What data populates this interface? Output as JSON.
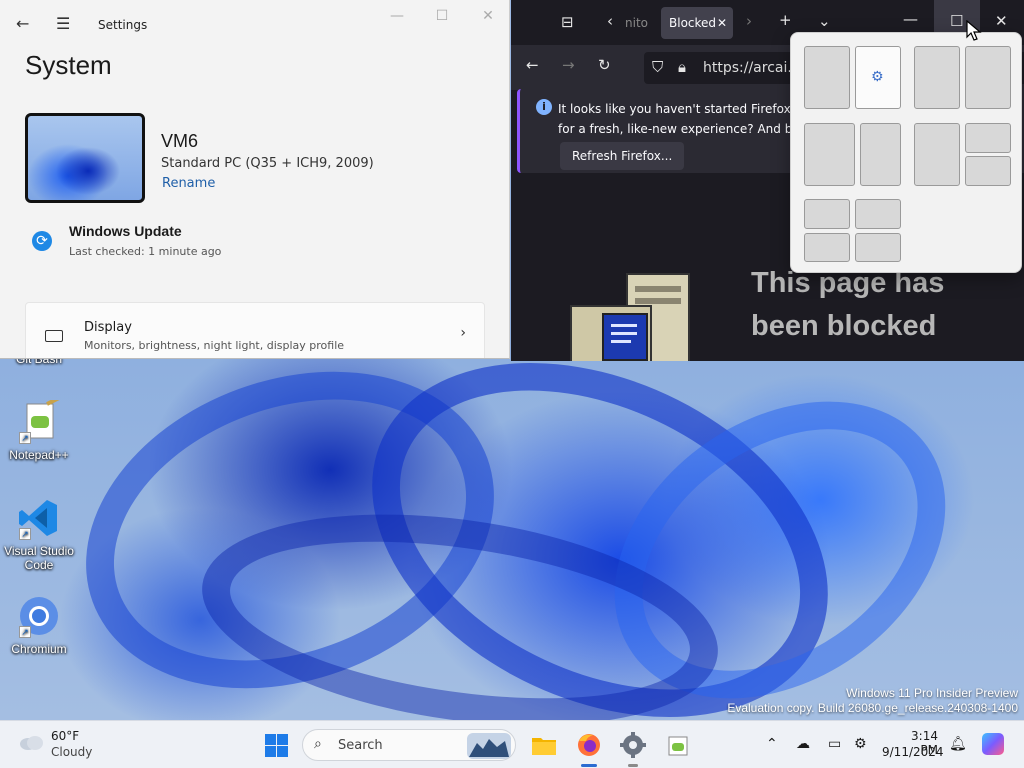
{
  "desktop": {
    "icons": [
      {
        "label": "Git Bash"
      },
      {
        "label": "Notepad++"
      },
      {
        "label": "Visual Studio Code"
      },
      {
        "label": "Chromium"
      }
    ],
    "watermark_line1": "Windows 11 Pro Insider Preview",
    "watermark_line2": "Evaluation copy. Build 26080.ge_release.240308-1400"
  },
  "settings": {
    "window_title": "Settings",
    "heading": "System",
    "device_name": "VM6",
    "device_model": "Standard PC (Q35 + ICH9, 2009)",
    "rename_link": "Rename",
    "update_title": "Windows Update",
    "update_sub": "Last checked: 1 minute ago",
    "display_title": "Display",
    "display_sub": "Monitors, brightness, night light, display profile"
  },
  "firefox": {
    "partial_tab": "nito",
    "active_tab": "Blocked",
    "url": "https://arcai.co",
    "notification_line1": "It looks like you haven't started Firefox in a w",
    "notification_line2": "for a fresh, like-new experience? And by the w",
    "refresh_button": "Refresh Firefox...",
    "blocked_line1": "This page has",
    "blocked_line2": "been blocked"
  },
  "taskbar": {
    "weather_temp": "60°F",
    "weather_desc": "Cloudy",
    "search_label": "Search",
    "time": "3:14 PM",
    "date": "9/11/2024"
  },
  "colors": {
    "accent": "#1e88e5",
    "firefox_bg": "#1c1b22",
    "firefox_notification_stripe": "#8e55ff"
  }
}
